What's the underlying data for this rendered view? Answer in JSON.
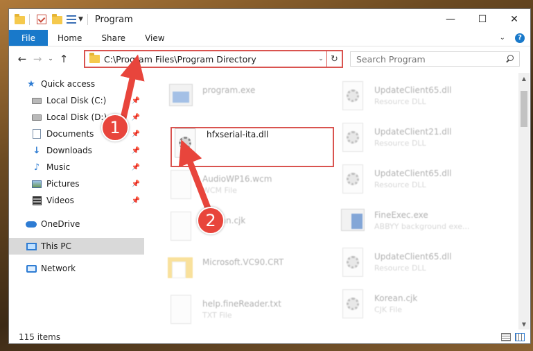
{
  "window": {
    "title": "Program",
    "controls": {
      "minimize": "—",
      "maximize": "☐",
      "close": "✕"
    }
  },
  "ribbon": {
    "tabs": [
      "File",
      "Home",
      "Share",
      "View"
    ],
    "help": "?"
  },
  "address": {
    "path": "C:\\Program Files\\Program Directory",
    "search_placeholder": "Search Program"
  },
  "sidebar": {
    "items": [
      {
        "label": "Quick access",
        "icon": "star-icon",
        "pinned": false
      },
      {
        "label": "Local Disk (C:)",
        "icon": "drive-icon",
        "pinned": true
      },
      {
        "label": "Local Disk (D:)",
        "icon": "drive-icon",
        "pinned": true
      },
      {
        "label": "Documents",
        "icon": "documents-icon",
        "pinned": true
      },
      {
        "label": "Downloads",
        "icon": "downloads-icon",
        "pinned": true
      },
      {
        "label": "Music",
        "icon": "music-icon",
        "pinned": true
      },
      {
        "label": "Pictures",
        "icon": "pictures-icon",
        "pinned": true
      },
      {
        "label": "Videos",
        "icon": "videos-icon",
        "pinned": true
      },
      {
        "label": "OneDrive",
        "icon": "cloud-icon",
        "pinned": false
      },
      {
        "label": "This PC",
        "icon": "computer-icon",
        "pinned": false,
        "selected": true
      },
      {
        "label": "Network",
        "icon": "network-icon",
        "pinned": false
      }
    ]
  },
  "files": [
    {
      "name": "program.exe",
      "type": "",
      "icon": "exe-icon"
    },
    {
      "name": "hfxserial-ita.dll",
      "type": "",
      "icon": "dll-gear-icon"
    },
    {
      "name": "AudioWP16.wcm",
      "type": "WCM File",
      "icon": "blank-file-icon"
    },
    {
      "name": "Korean.cjk",
      "type": "",
      "icon": "blank-file-icon"
    },
    {
      "name": "Microsoft.VC90.CRT",
      "type": "",
      "icon": "folder-icon"
    },
    {
      "name": "help.fineReader.txt",
      "type": "TXT File",
      "icon": "text-file-icon"
    },
    {
      "name": "UpdateClient65.dll",
      "type": "Resource DLL",
      "icon": "dll-gear-icon"
    },
    {
      "name": "UpdateClient21.dll",
      "type": "Resource DLL",
      "icon": "dll-gear-icon"
    },
    {
      "name": "UpdateClient65.dll",
      "type": "Resource DLL",
      "icon": "dll-gear-icon"
    },
    {
      "name": "FineExec.exe",
      "type": "ABBYY background exe...",
      "icon": "exe-icon"
    },
    {
      "name": "UpdateClient65.dll",
      "type": "Resource DLL",
      "icon": "dll-gear-icon"
    },
    {
      "name": "Korean.cjk",
      "type": "CJK File",
      "icon": "dll-gear-icon"
    }
  ],
  "status": {
    "item_count": "115 items"
  },
  "annotations": {
    "step1": "1",
    "step2": "2",
    "color": "#e8453c"
  }
}
